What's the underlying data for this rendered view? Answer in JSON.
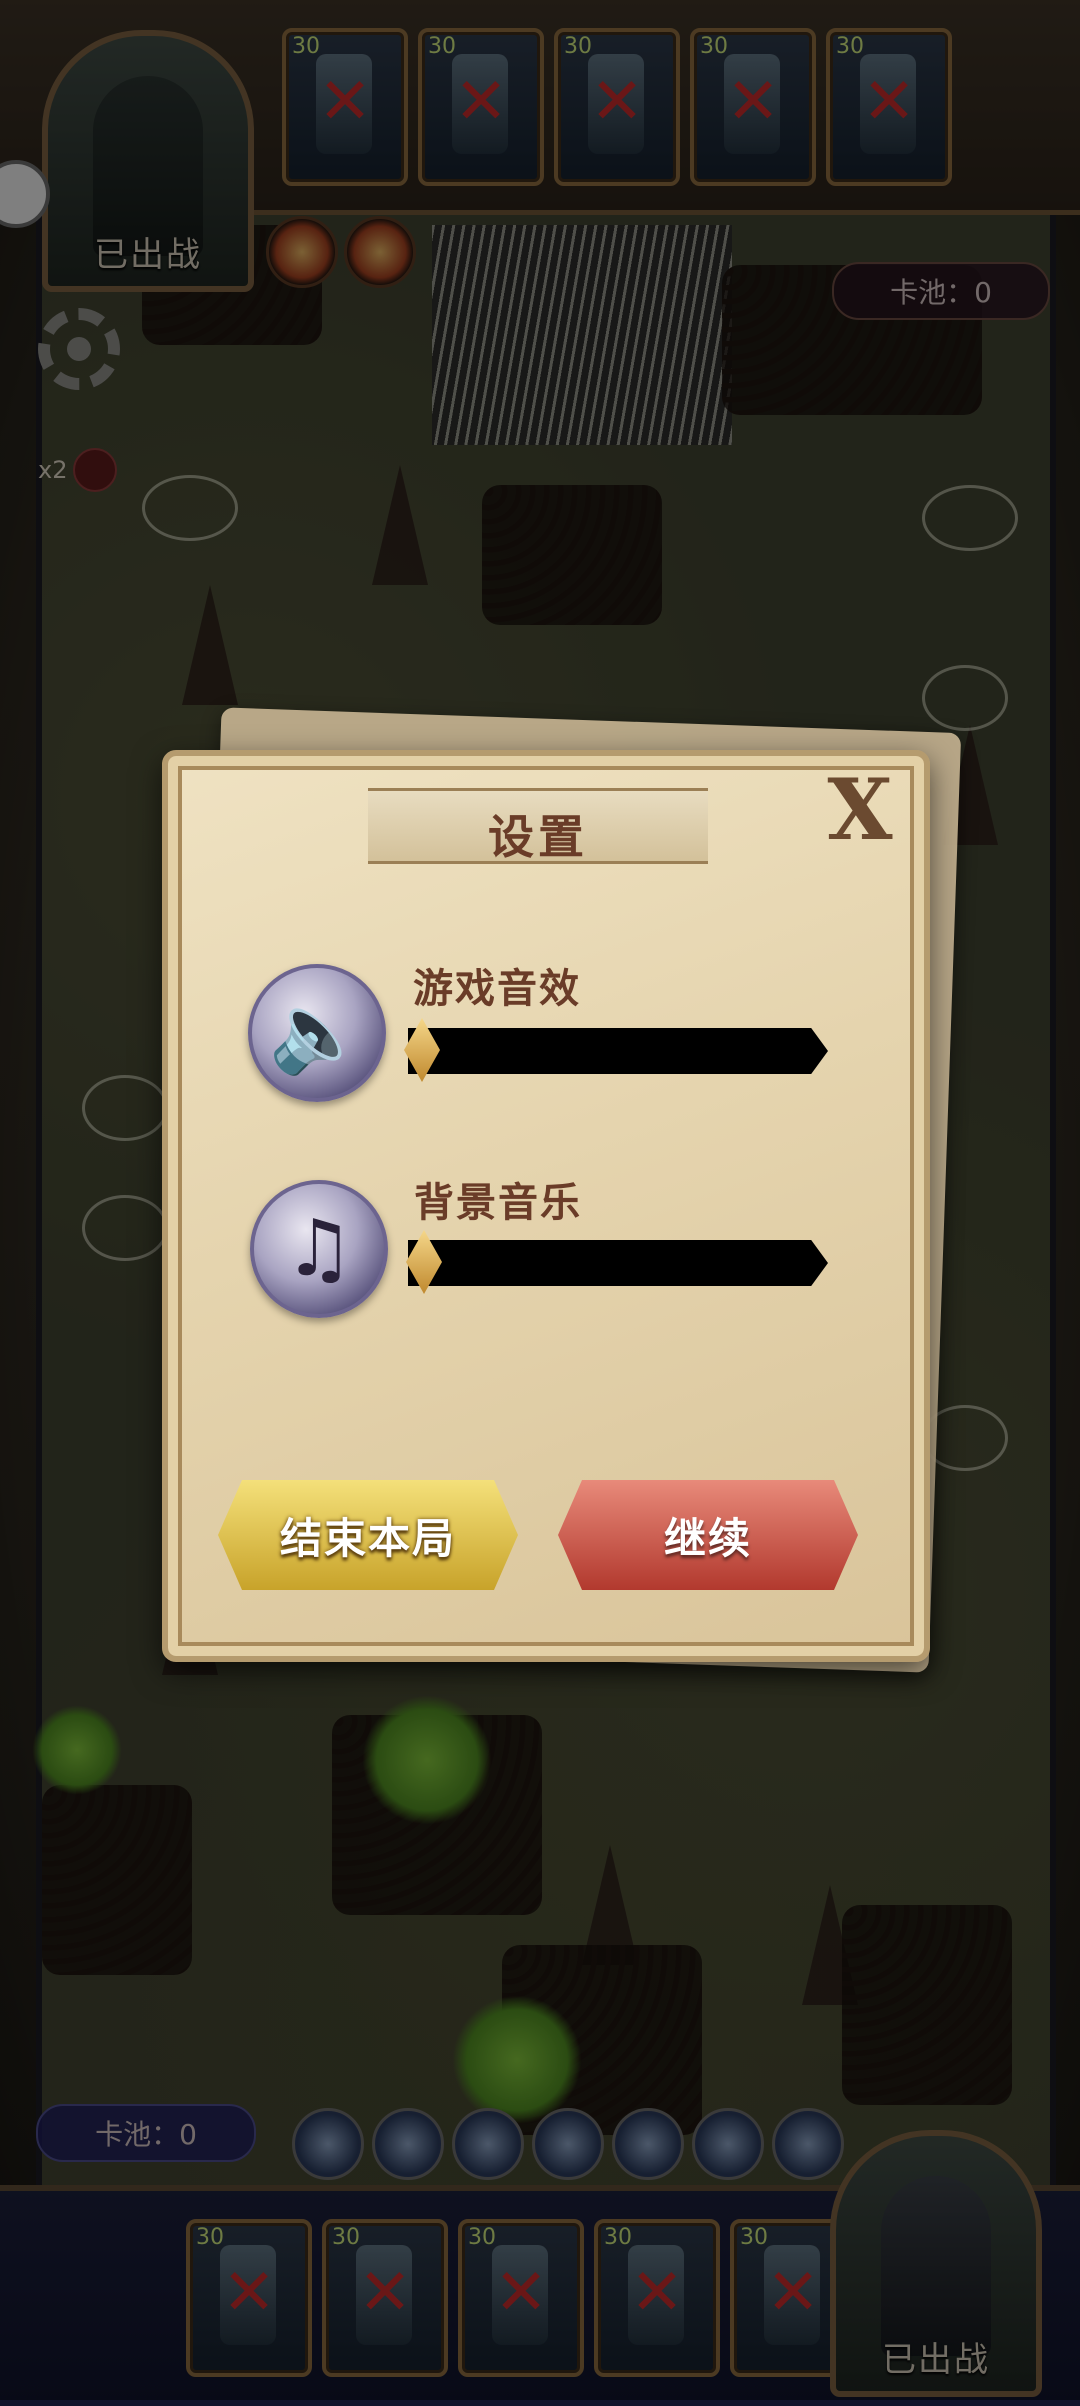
{
  "hud": {
    "top_pool": "卡池：0",
    "bottom_pool": "卡池：0",
    "speed": "x2",
    "enemy_portrait_status": "已出战",
    "player_portrait_status": "已出战",
    "top_cards": [
      {
        "cost": "30",
        "icon": "disabled-x-icon"
      },
      {
        "cost": "30",
        "icon": "disabled-x-icon"
      },
      {
        "cost": "30",
        "icon": "disabled-x-icon"
      },
      {
        "cost": "30",
        "icon": "disabled-x-icon"
      },
      {
        "cost": "30",
        "icon": "disabled-x-icon"
      }
    ],
    "bottom_cards": [
      {
        "cost": "30",
        "icon": "disabled-x-icon"
      },
      {
        "cost": "30",
        "icon": "disabled-x-icon"
      },
      {
        "cost": "30",
        "icon": "disabled-x-icon"
      },
      {
        "cost": "30",
        "icon": "disabled-x-icon"
      },
      {
        "cost": "30",
        "icon": "disabled-x-icon"
      }
    ]
  },
  "settings": {
    "title": "设置",
    "close": "X",
    "sound_effects": {
      "label": "游戏音效",
      "icon": "speaker-icon",
      "value": 0
    },
    "music": {
      "label": "背景音乐",
      "icon": "music-note-icon",
      "value": 0
    },
    "end_button": "结束本局",
    "continue_button": "继续"
  },
  "colors": {
    "dialog_text": "#6a3c28",
    "end_button": "#e8c84a",
    "continue_button": "#c94a3e"
  }
}
